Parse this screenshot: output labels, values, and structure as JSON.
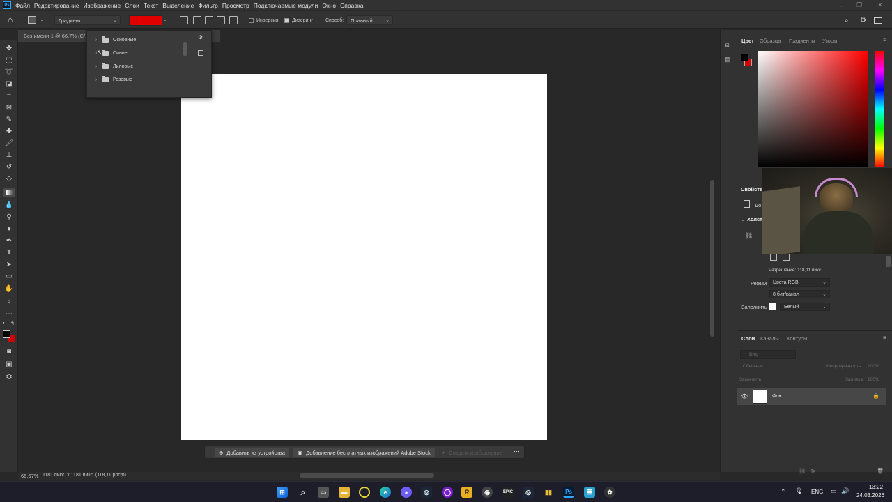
{
  "menu": {
    "logo": "Ps",
    "items": [
      "Файл",
      "Редактирование",
      "Изображение",
      "Слои",
      "Текст",
      "Выделение",
      "Фильтр",
      "Просмотр",
      "Подключаемые модули",
      "Окно",
      "Справка"
    ]
  },
  "options_bar": {
    "tool_preset": "Градиент",
    "gradient_color": "#e00000",
    "inversion_label": "Инверсия",
    "inversion_checked": false,
    "dither_label": "Дизеринг",
    "dither_checked": true,
    "method_label": "Способ:",
    "method_value": "Плавный"
  },
  "document": {
    "tab_title": "Без имени-1 @ 66,7% (С/..."
  },
  "gradient_presets": {
    "folders": [
      "Основные",
      "Синие",
      "Лиловые",
      "Розовые"
    ]
  },
  "color_panel": {
    "tabs": [
      "Цвет",
      "Образцы",
      "Градиенты",
      "Узоры"
    ],
    "active_tab": "Цвет",
    "foreground": "#000000",
    "background": "#d10000"
  },
  "properties_panel": {
    "tab": "Свойства",
    "doc_label": "До",
    "canvas_section": "Холст",
    "resolution": "Разрешение: 118,11 пикс...",
    "mode_label": "Режим",
    "mode_value": "Цвета RGB",
    "depth_value": "8 бит/канал",
    "fill_label": "Заполнить",
    "fill_value": "Белый"
  },
  "layers_panel": {
    "tabs": [
      "Слои",
      "Каналы",
      "Контуры"
    ],
    "active_tab": "Слои",
    "search_placeholder": "Вид",
    "blend_mode": "Обычные",
    "opacity_label": "Непрозрачность:",
    "opacity_value": "100%",
    "lock_label": "Закрепить:",
    "fill_label": "Заливка:",
    "fill_value": "100%",
    "layers": [
      {
        "name": "Фон",
        "locked": true,
        "visible": true
      }
    ]
  },
  "context_bar": {
    "btn_device": "Добавить из устройства",
    "btn_stock": "Добавление бесплатных изображений Adobe Stock",
    "btn_generate": "Создать изображение"
  },
  "status": {
    "zoom": "66.67%",
    "size": "1181 пикс. x 1181 пикс. (118,11 ppcm)"
  },
  "taskbar": {
    "lang": "ENG",
    "time": "13:22",
    "date": "24.03.2026"
  }
}
